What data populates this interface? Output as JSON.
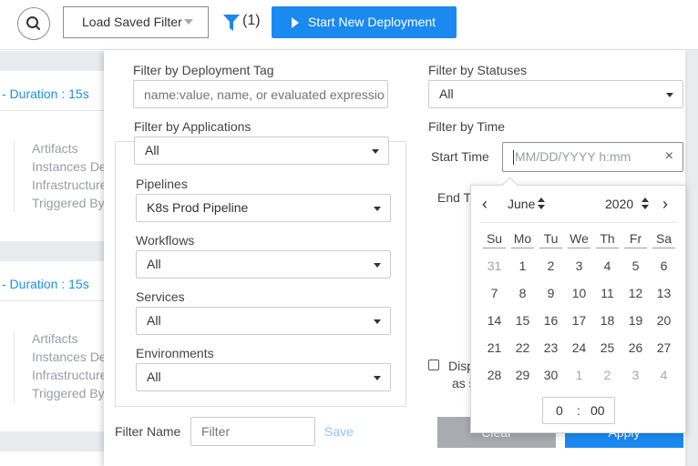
{
  "toolbar": {
    "load_filter_label": "Load Saved Filter",
    "filter_count": "(1)",
    "start_label": "Start New Deployment"
  },
  "background": {
    "rows": [
      {
        "duration": "- Duration : 15s",
        "meta": [
          "Artifacts",
          "Instances Deployed",
          "Infrastructure",
          "Triggered By"
        ]
      },
      {
        "duration": "- Duration : 15s",
        "meta": [
          "Artifacts",
          "Instances Deployed",
          "Infrastructure",
          "Triggered By"
        ]
      }
    ]
  },
  "filter": {
    "tag_label": "Filter by Deployment Tag",
    "tag_placeholder": "name:value, name, or evaluated expression",
    "apps_label": "Filter by Applications",
    "apps_value": "All",
    "pipelines_label": "Pipelines",
    "pipelines_value": "K8s Prod Pipeline",
    "workflows_label": "Workflows",
    "workflows_value": "All",
    "services_label": "Services",
    "services_value": "All",
    "env_label": "Environments",
    "env_value": "All",
    "status_label": "Filter by Statuses",
    "status_value": "All",
    "time_label": "Filter by Time",
    "start_time_label": "Start Time",
    "start_time_placeholder": "MM/DD/YYYY h:mm",
    "end_time_label": "End Time",
    "checkbox_label_line1": "Display",
    "checkbox_label_line2": "as s",
    "filter_name_label": "Filter Name",
    "filter_name_placeholder": "Filter",
    "save_label": "Save",
    "clear_label": "Clear",
    "apply_label": "Apply"
  },
  "datepicker": {
    "month": "June",
    "year": "2020",
    "weekdays": [
      "Su",
      "Mo",
      "Tu",
      "We",
      "Th",
      "Fr",
      "Sa"
    ],
    "weeks": [
      [
        "31",
        "1",
        "2",
        "3",
        "4",
        "5",
        "6"
      ],
      [
        "7",
        "8",
        "9",
        "10",
        "11",
        "12",
        "13"
      ],
      [
        "14",
        "15",
        "16",
        "17",
        "18",
        "19",
        "20"
      ],
      [
        "21",
        "22",
        "23",
        "24",
        "25",
        "26",
        "27"
      ],
      [
        "28",
        "29",
        "30",
        "1",
        "2",
        "3",
        "4"
      ]
    ],
    "hour": "0",
    "minute": "00"
  },
  "colors": {
    "primary": "#1a89f0",
    "link": "#1f8fe0",
    "muted_text": "#9a9da3"
  }
}
